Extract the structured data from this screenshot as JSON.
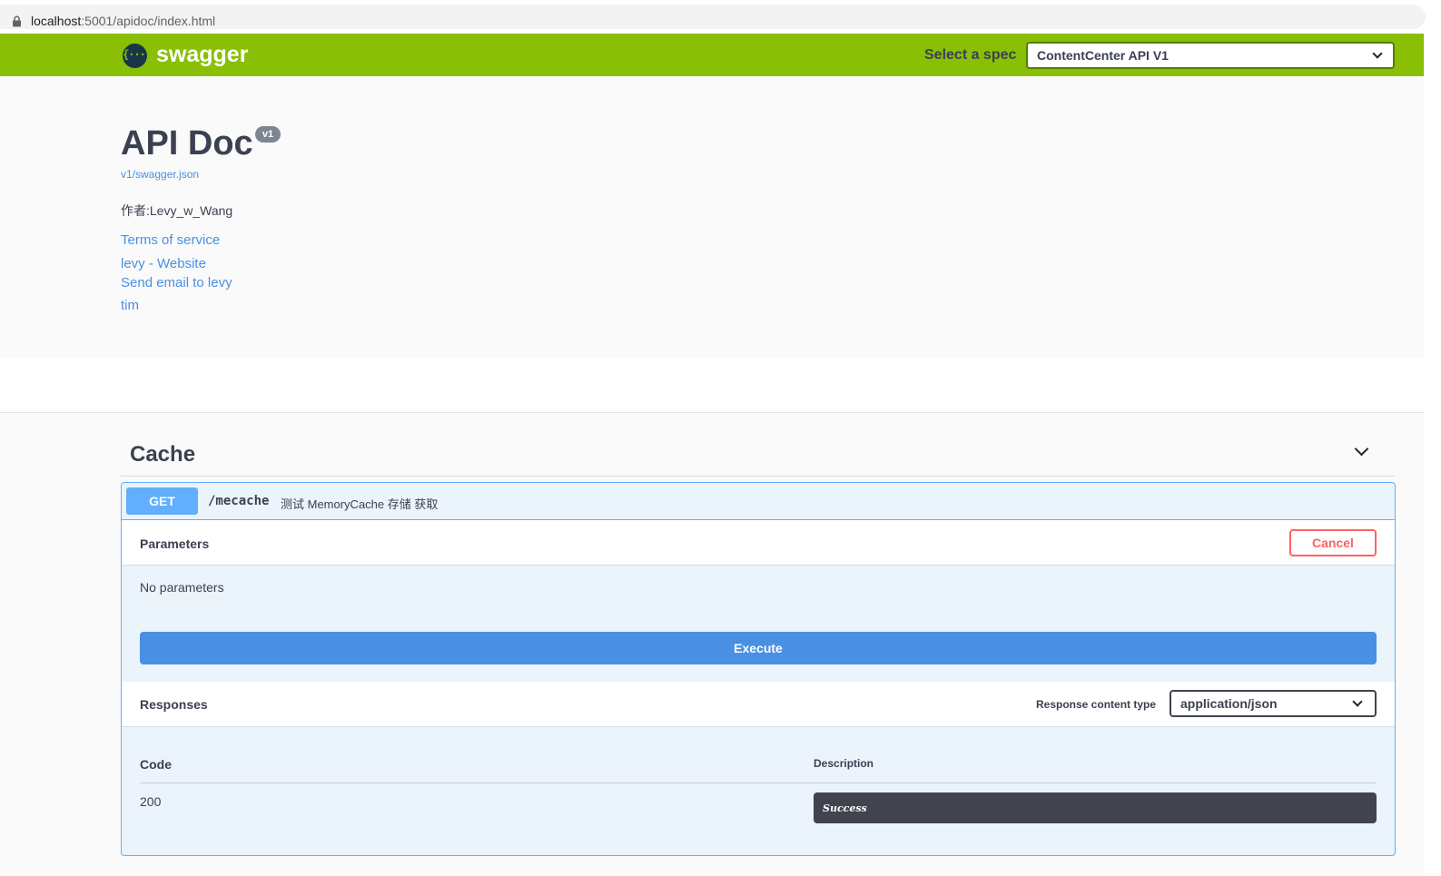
{
  "browser": {
    "url_host": "localhost",
    "url_rest": ":5001/apidoc/index.html"
  },
  "topbar": {
    "logo_glyph": "{···}",
    "logo_text": "swagger",
    "spec_label": "Select a spec",
    "spec_value": "ContentCenter API V1",
    "colors": {
      "bar": "#89bf04",
      "logo_bg": "#173647"
    }
  },
  "info": {
    "title": "API Doc",
    "version": "v1",
    "json_link": "v1/swagger.json",
    "author": "作者:Levy_w_Wang",
    "links": [
      "Terms of service",
      "levy - Website",
      "Send email to levy",
      "tim"
    ]
  },
  "tag": {
    "name": "Cache"
  },
  "operation": {
    "method": "GET",
    "path": "/mecache",
    "summary": "测试 MemoryCache 存储 获取",
    "parameters_label": "Parameters",
    "cancel_label": "Cancel",
    "no_params": "No parameters",
    "execute_label": "Execute",
    "responses_label": "Responses",
    "content_type_label": "Response content type",
    "content_type_value": "application/json",
    "table_headers": {
      "code": "Code",
      "description": "Description"
    },
    "responses": [
      {
        "code": "200",
        "description": "Success"
      }
    ],
    "colors": {
      "get": "#61affe",
      "execute": "#4990e2",
      "cancel": "#ff6060"
    }
  }
}
